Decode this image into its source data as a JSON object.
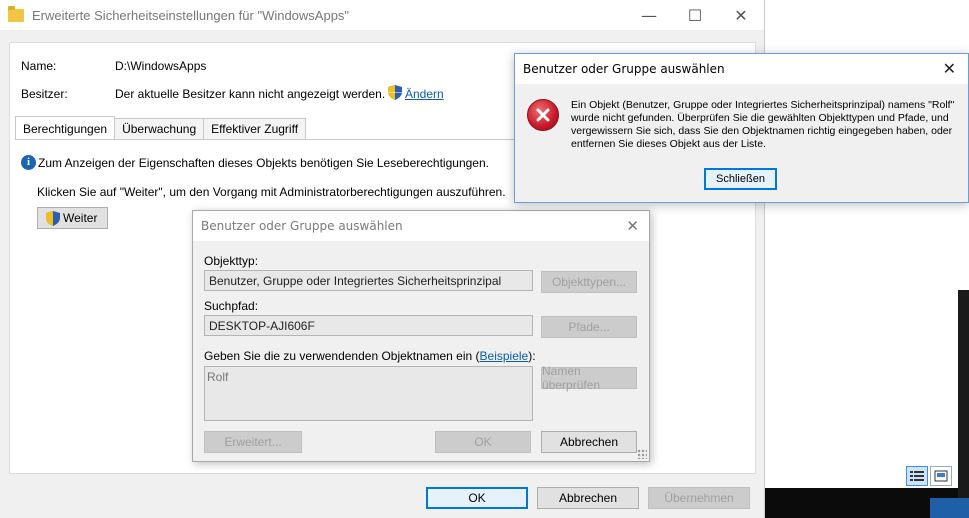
{
  "main_window": {
    "title": "Erweiterte Sicherheitseinstellungen für \"WindowsApps\"",
    "name_label": "Name:",
    "name_value": "D:\\WindowsApps",
    "owner_label": "Besitzer:",
    "owner_value": "Der aktuelle Besitzer kann nicht angezeigt werden.",
    "owner_change_link": "Ändern",
    "tabs": [
      {
        "label": "Berechtigungen"
      },
      {
        "label": "Überwachung"
      },
      {
        "label": "Effektiver Zugriff"
      }
    ],
    "info_text": "Zum Anzeigen der Eigenschaften dieses Objekts benötigen Sie Leseberechtigungen.",
    "continue_text": "Klicken Sie auf \"Weiter\", um den Vorgang mit Administratorberechtigungen auszuführen.",
    "weiter_label": "Weiter",
    "ok_label": "OK",
    "cancel_label": "Abbrechen",
    "apply_label": "Übernehmen"
  },
  "select_dialog": {
    "title": "Benutzer oder Gruppe auswählen",
    "object_type_label": "Objekttyp:",
    "object_type_value": "Benutzer, Gruppe oder Integriertes Sicherheitsprinzipal",
    "object_types_button": "Objekttypen...",
    "search_path_label": "Suchpfad:",
    "search_path_value": "DESKTOP-AJI606F",
    "paths_button": "Pfade...",
    "names_label_prefix": "Geben Sie die zu verwendenden Objektnamen ein (",
    "names_label_link": "Beispiele",
    "names_label_suffix": "):",
    "names_value": "Rolf",
    "check_names_button": "Namen überprüfen",
    "advanced_button": "Erweitert...",
    "ok_button": "OK",
    "cancel_button": "Abbrechen"
  },
  "error_dialog": {
    "title": "Benutzer oder Gruppe auswählen",
    "message": "Ein Objekt (Benutzer, Gruppe oder Integriertes Sicherheitsprinzipal) namens \"Rolf\" wurde nicht gefunden. Überprüfen Sie die gewählten Objekttypen und Pfade, und vergewissern Sie sich, dass Sie den Objektnamen richtig eingegeben haben, oder entfernen Sie dieses Objekt aus der Liste.",
    "close_button": "Schließen",
    "icon": "error-icon",
    "accent": "#0078d7"
  }
}
